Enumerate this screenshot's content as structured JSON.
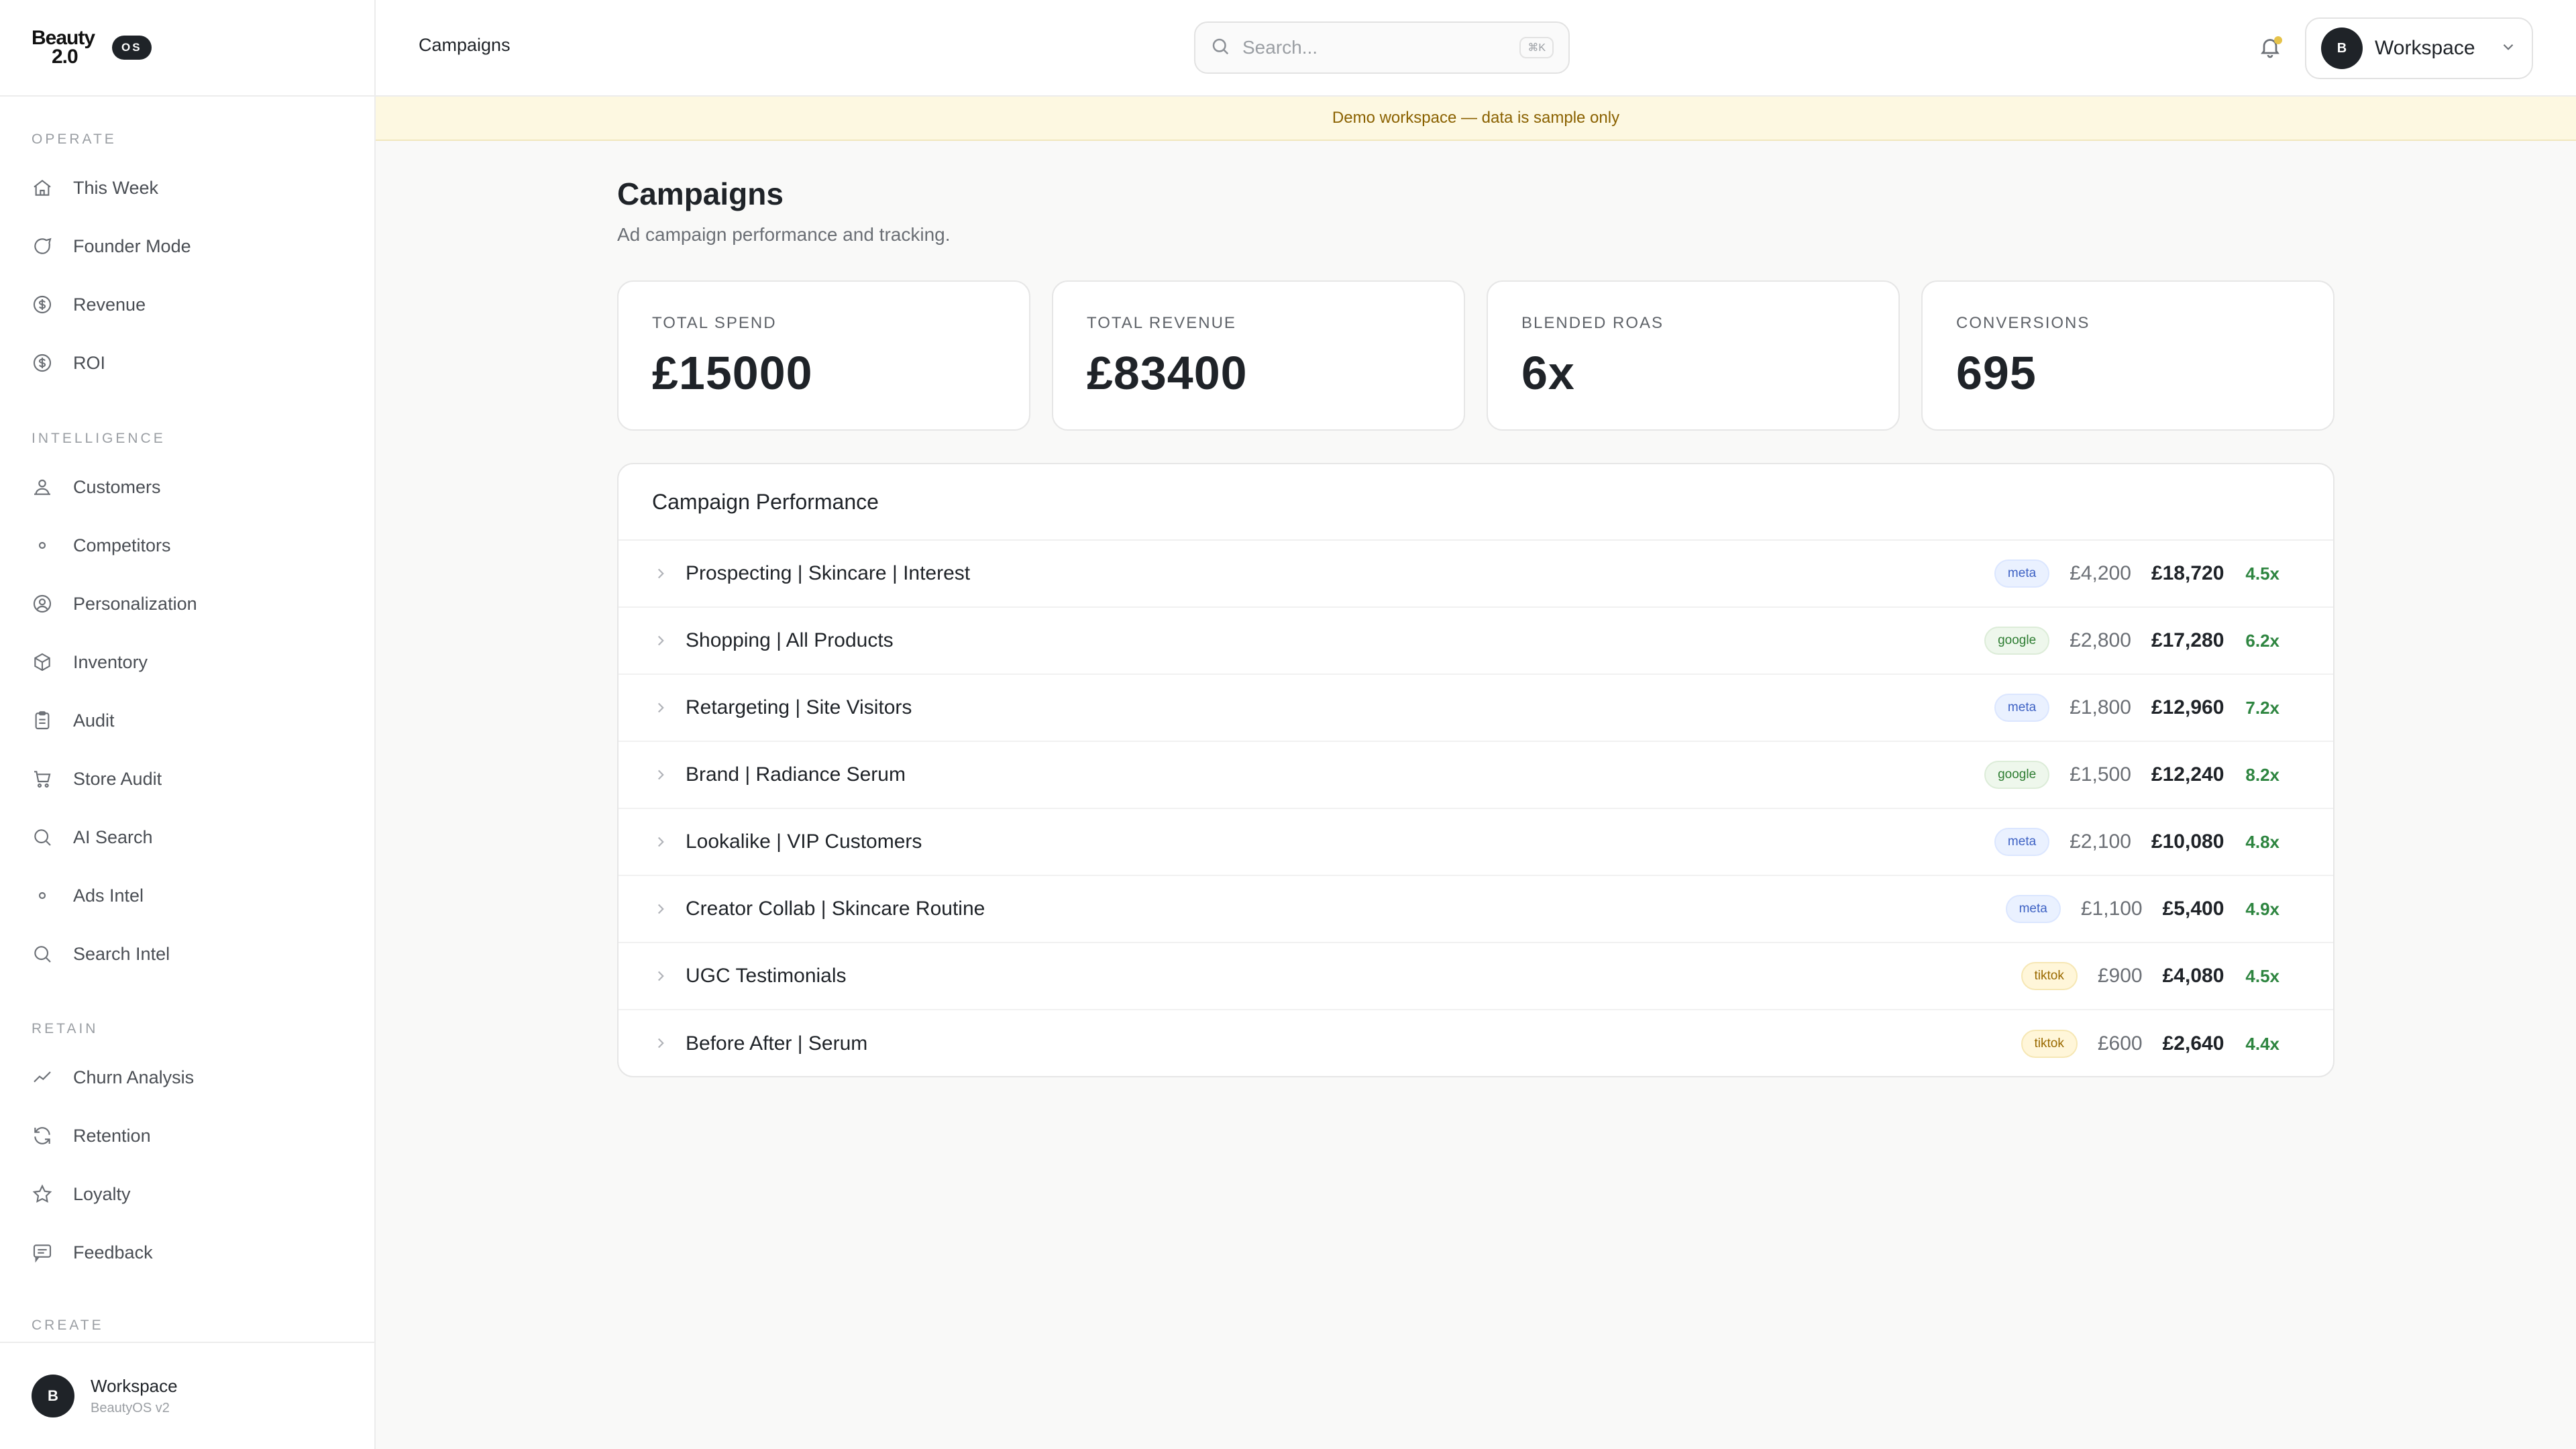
{
  "brand": {
    "line1": "Beauty",
    "line2": "2.0",
    "badge": "OS"
  },
  "sidebar": {
    "sections": [
      {
        "label": "OPERATE",
        "items": [
          {
            "label": "This Week",
            "icon": "home-icon"
          },
          {
            "label": "Founder Mode",
            "icon": "chat-icon"
          },
          {
            "label": "Revenue",
            "icon": "dollar-icon"
          },
          {
            "label": "ROI",
            "icon": "dollar-icon"
          }
        ]
      },
      {
        "label": "INTELLIGENCE",
        "items": [
          {
            "label": "Customers",
            "icon": "users-icon"
          },
          {
            "label": "Competitors",
            "icon": "dot-icon"
          },
          {
            "label": "Personalization",
            "icon": "user-circle-icon"
          },
          {
            "label": "Inventory",
            "icon": "box-icon"
          },
          {
            "label": "Audit",
            "icon": "clipboard-icon"
          },
          {
            "label": "Store Audit",
            "icon": "cart-icon"
          },
          {
            "label": "AI Search",
            "icon": "search-icon"
          },
          {
            "label": "Ads Intel",
            "icon": "dot-icon"
          },
          {
            "label": "Search Intel",
            "icon": "search-icon"
          }
        ]
      },
      {
        "label": "RETAIN",
        "items": [
          {
            "label": "Churn Analysis",
            "icon": "trend-icon"
          },
          {
            "label": "Retention",
            "icon": "refresh-icon"
          },
          {
            "label": "Loyalty",
            "icon": "star-icon"
          },
          {
            "label": "Feedback",
            "icon": "message-icon"
          }
        ]
      },
      {
        "label": "CREATE",
        "items": []
      }
    ],
    "footer": {
      "avatar": "B",
      "name": "Workspace",
      "sub": "BeautyOS v2"
    }
  },
  "topbar": {
    "breadcrumb": "Campaigns",
    "search_placeholder": "Search...",
    "search_shortcut": "⌘K",
    "workspace_avatar": "B",
    "workspace_label": "Workspace"
  },
  "banner": "Demo workspace — data is sample only",
  "page": {
    "title": "Campaigns",
    "subtitle": "Ad campaign performance and tracking."
  },
  "stats": [
    {
      "label": "TOTAL SPEND",
      "value": "£15000"
    },
    {
      "label": "TOTAL REVENUE",
      "value": "£83400"
    },
    {
      "label": "BLENDED ROAS",
      "value": "6x"
    },
    {
      "label": "CONVERSIONS",
      "value": "695"
    }
  ],
  "performance": {
    "title": "Campaign Performance",
    "rows": [
      {
        "name": "Prospecting | Skincare | Interest",
        "platform": "meta",
        "spend": "£4,200",
        "revenue": "£18,720",
        "roas": "4.5x"
      },
      {
        "name": "Shopping | All Products",
        "platform": "google",
        "spend": "£2,800",
        "revenue": "£17,280",
        "roas": "6.2x"
      },
      {
        "name": "Retargeting | Site Visitors",
        "platform": "meta",
        "spend": "£1,800",
        "revenue": "£12,960",
        "roas": "7.2x"
      },
      {
        "name": "Brand | Radiance Serum",
        "platform": "google",
        "spend": "£1,500",
        "revenue": "£12,240",
        "roas": "8.2x"
      },
      {
        "name": "Lookalike | VIP Customers",
        "platform": "meta",
        "spend": "£2,100",
        "revenue": "£10,080",
        "roas": "4.8x"
      },
      {
        "name": "Creator Collab | Skincare Routine",
        "platform": "meta",
        "spend": "£1,100",
        "revenue": "£5,400",
        "roas": "4.9x"
      },
      {
        "name": "UGC Testimonials",
        "platform": "tiktok",
        "spend": "£900",
        "revenue": "£4,080",
        "roas": "4.5x"
      },
      {
        "name": "Before After | Serum",
        "platform": "tiktok",
        "spend": "£600",
        "revenue": "£2,640",
        "roas": "4.4x"
      }
    ]
  },
  "colors": {
    "accent": "#1f2328",
    "roas_green": "#2e8540",
    "banner_bg": "#fdf8e1",
    "banner_text": "#8a6100"
  }
}
